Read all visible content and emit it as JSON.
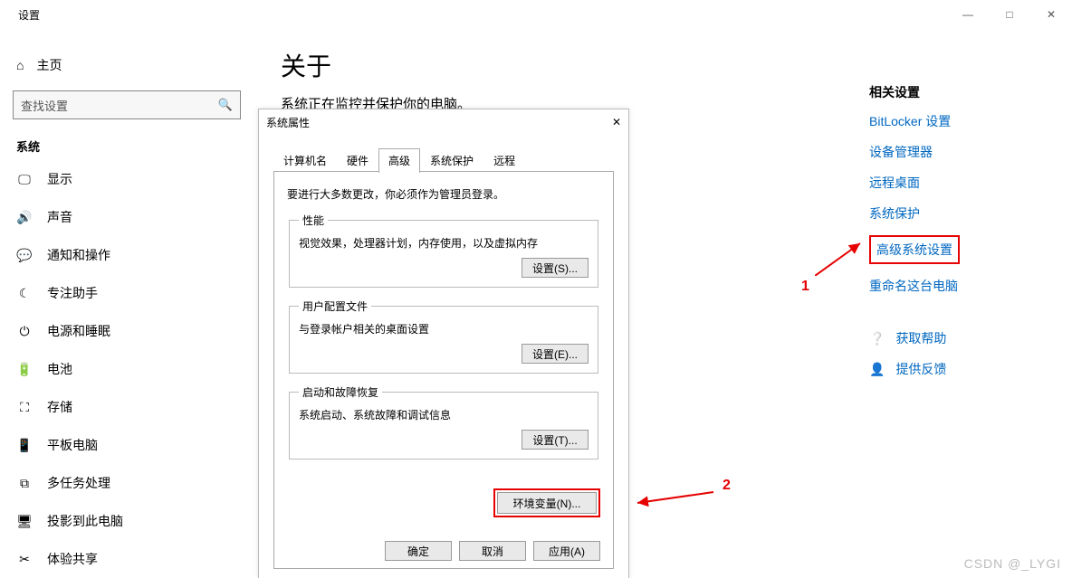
{
  "window": {
    "title": "设置"
  },
  "winctrl": {
    "min": "—",
    "max": "□",
    "close": "✕"
  },
  "sidebar": {
    "home": "主页",
    "search_placeholder": "查找设置",
    "section": "系统",
    "items": [
      {
        "icon": "🖵",
        "label": "显示"
      },
      {
        "icon": "🔊",
        "label": "声音"
      },
      {
        "icon": "💬",
        "label": "通知和操作"
      },
      {
        "icon": "☾",
        "label": "专注助手"
      },
      {
        "icon": "⏻",
        "label": "电源和睡眠"
      },
      {
        "icon": "🔋",
        "label": "电池"
      },
      {
        "icon": "⛶",
        "label": "存储"
      },
      {
        "icon": "📱",
        "label": "平板电脑"
      },
      {
        "icon": "⧉",
        "label": "多任务处理"
      },
      {
        "icon": "🖥",
        "label": "投影到此电脑"
      },
      {
        "icon": "✂",
        "label": "体验共享"
      }
    ]
  },
  "main": {
    "title": "关于",
    "subtitle": "系统正在监控并保护你的电脑。"
  },
  "right": {
    "head": "相关设置",
    "links": [
      "BitLocker 设置",
      "设备管理器",
      "远程桌面",
      "系统保护",
      "高级系统设置",
      "重命名这台电脑"
    ],
    "help": "获取帮助",
    "feedback": "提供反馈"
  },
  "dialog": {
    "title": "系统属性",
    "tabs": [
      "计算机名",
      "硬件",
      "高级",
      "系统保护",
      "远程"
    ],
    "active_tab": 2,
    "note": "要进行大多数更改，你必须作为管理员登录。",
    "groups": [
      {
        "legend": "性能",
        "text": "视觉效果，处理器计划，内存使用，以及虚拟内存",
        "btn": "设置(S)..."
      },
      {
        "legend": "用户配置文件",
        "text": "与登录帐户相关的桌面设置",
        "btn": "设置(E)..."
      },
      {
        "legend": "启动和故障恢复",
        "text": "系统启动、系统故障和调试信息",
        "btn": "设置(T)..."
      }
    ],
    "env_btn": "环境变量(N)...",
    "footer": {
      "ok": "确定",
      "cancel": "取消",
      "apply": "应用(A)"
    }
  },
  "anno": {
    "n1": "1",
    "n2": "2"
  },
  "watermark": "CSDN @_LYGI"
}
